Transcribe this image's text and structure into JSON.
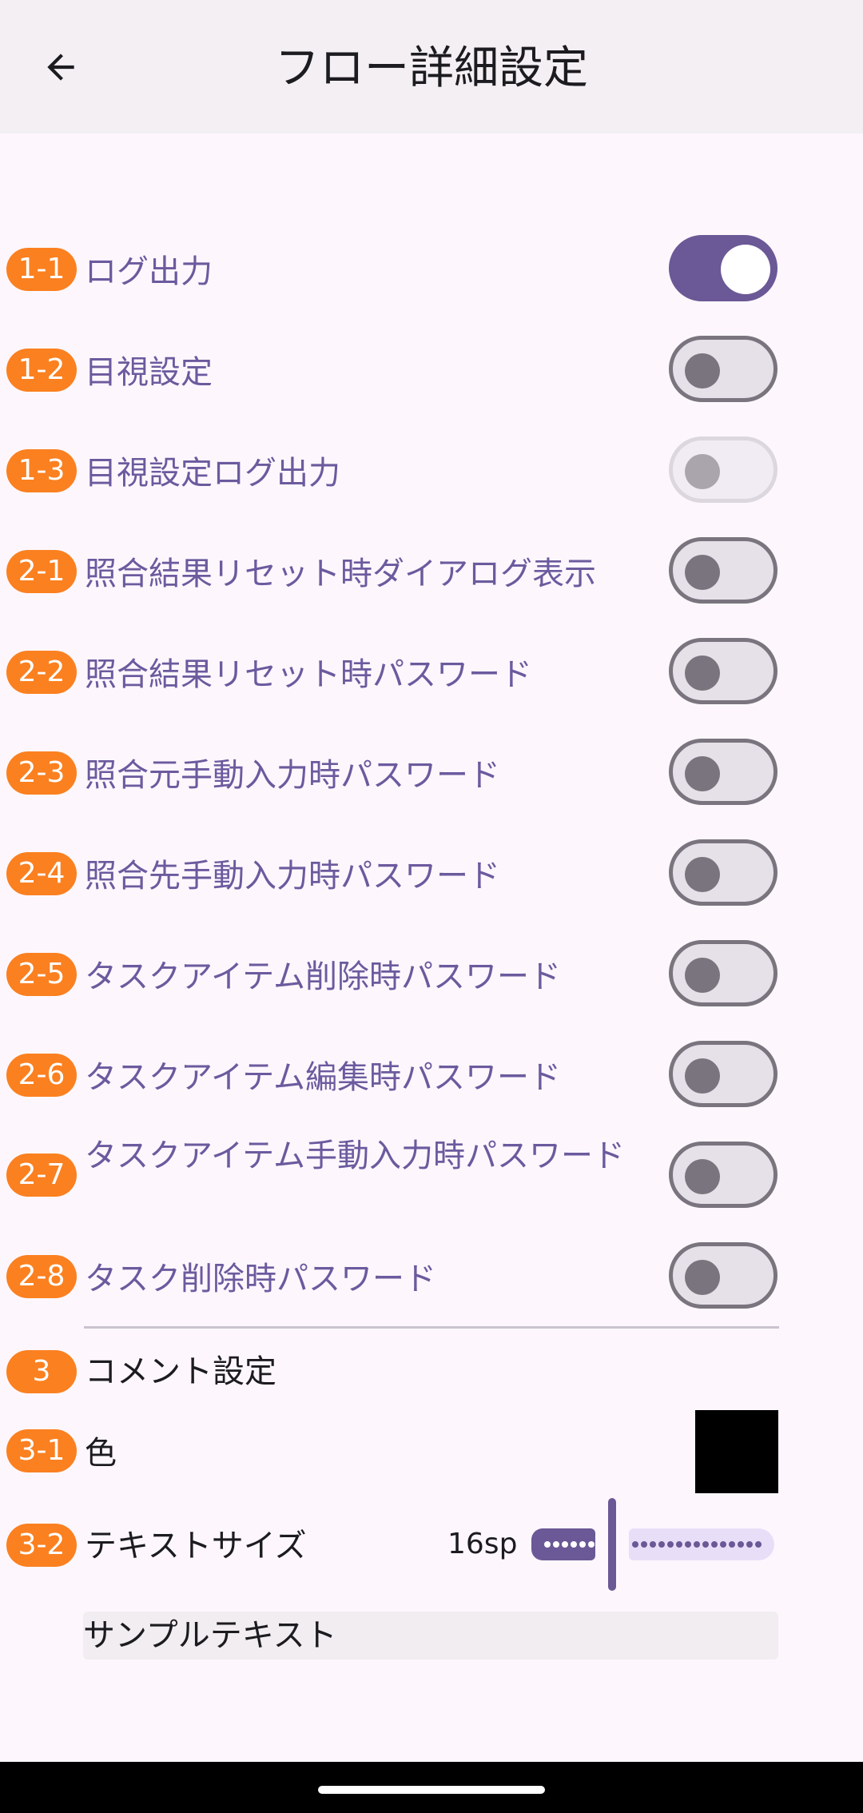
{
  "appbar": {
    "title": "フロー詳細設定",
    "back_icon": "arrow-left-icon"
  },
  "settings": [
    {
      "badge": "1-1",
      "label": "ログ出力",
      "state": "on"
    },
    {
      "badge": "1-2",
      "label": "目視設定",
      "state": "off"
    },
    {
      "badge": "1-3",
      "label": "目視設定ログ出力",
      "state": "disabled"
    },
    {
      "badge": "2-1",
      "label": "照合結果リセット時ダイアログ表示",
      "state": "off"
    },
    {
      "badge": "2-2",
      "label": "照合結果リセット時パスワード",
      "state": "off"
    },
    {
      "badge": "2-3",
      "label": "照合元手動入力時パスワード",
      "state": "off"
    },
    {
      "badge": "2-4",
      "label": "照合先手動入力時パスワード",
      "state": "off"
    },
    {
      "badge": "2-5",
      "label": "タスクアイテム削除時パスワード",
      "state": "off"
    },
    {
      "badge": "2-6",
      "label": "タスクアイテム編集時パスワード",
      "state": "off"
    },
    {
      "badge": "2-7",
      "label": "タスクアイテム手動入力時パスワード",
      "state": "off"
    },
    {
      "badge": "2-8",
      "label": "タスク削除時パスワード",
      "state": "off"
    }
  ],
  "comment": {
    "badge": "3",
    "title": "コメント設定",
    "color_badge": "3-1",
    "color_label": "色",
    "color_value": "#000000",
    "size_badge": "3-2",
    "size_label": "テキストサイズ",
    "size_value": "16sp",
    "sample_text": "サンプルテキスト"
  },
  "colors": {
    "badge": "#fb8020",
    "accent": "#6b5896",
    "label_purple": "#6c5a9e"
  }
}
